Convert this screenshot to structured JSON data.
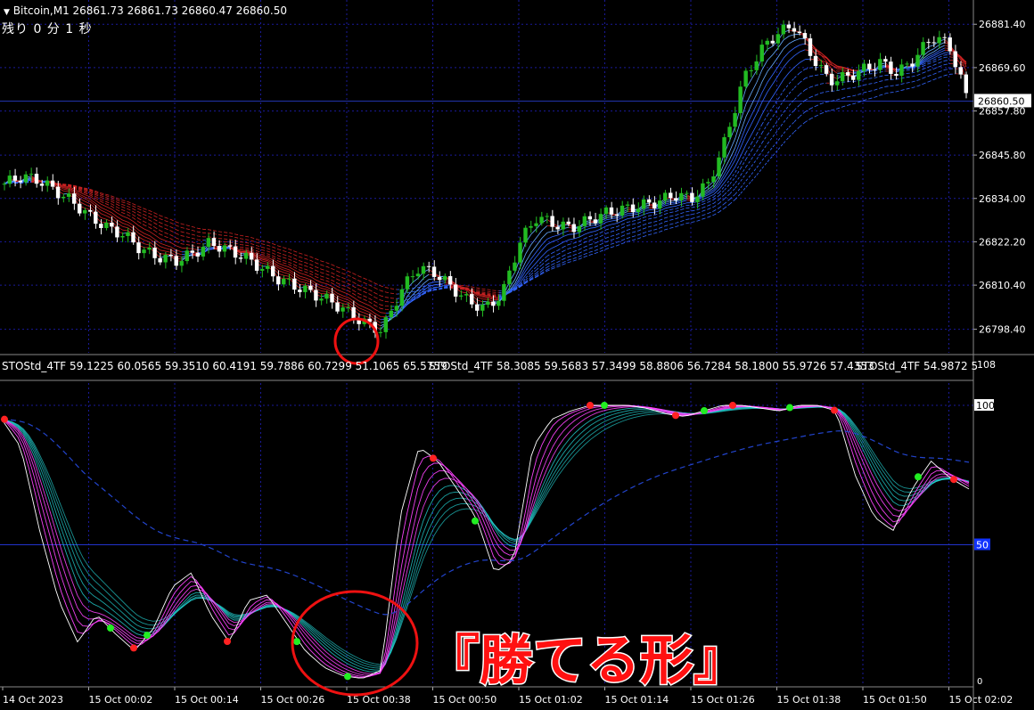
{
  "header": {
    "symbol_line": "Bitcoin,M1  26861.73 26861.73 26860.47 26860.50",
    "countdown": "残り 0 分 1 秒"
  },
  "indicator": {
    "label_1": "STOStd_4TF 59.1225 60.0565 59.3510 60.4191 59.7886 60.7299 51.1065 65.5759",
    "label_2": "STOStd_4TF 58.3085 59.5683 57.3499 58.8806 56.7284 58.1800 55.9726 57.4353",
    "label_3": "STOStd_4TF 54.9872 5",
    "scale_top": "108",
    "level_100": "100",
    "level_50": "50",
    "scale_bottom": "0"
  },
  "price_axis": {
    "ticks": [
      "26881.40",
      "26869.60",
      "26857.80",
      "26845.80",
      "26834.00",
      "26822.20",
      "26810.40",
      "26798.40"
    ],
    "current": "26860.50"
  },
  "time_axis": {
    "ticks": [
      "14 Oct 2023",
      "15 Oct 00:02",
      "15 Oct 00:14",
      "15 Oct 00:26",
      "15 Oct 00:38",
      "15 Oct 00:50",
      "15 Oct 01:02",
      "15 Oct 01:14",
      "15 Oct 01:26",
      "15 Oct 01:38",
      "15 Oct 01:50",
      "15 Oct 02:02"
    ]
  },
  "annotation": {
    "caption": "『勝てる形』"
  },
  "colors": {
    "grid": "#1a1a9a",
    "bull": "#22bb22",
    "bear": "#ffffff",
    "ma_down": "#cc2222",
    "ma_up": "#3366ff",
    "stoch_fast": "#ff44ff",
    "stoch_slow": "#22cccc",
    "marker_red": "#ff2222",
    "marker_green": "#22ee22"
  },
  "chart_data": {
    "type": "line",
    "title": "",
    "price_series": [
      26838,
      26840,
      26839,
      26836,
      26833,
      26829,
      26826,
      26824,
      26820,
      26818,
      26817,
      26819,
      26822,
      26820,
      26818,
      26815,
      26812,
      26810,
      26808,
      26806,
      26803,
      26800,
      26798,
      26808,
      26815,
      26814,
      26810,
      26806,
      26804,
      26808,
      26822,
      26829,
      26827,
      26826,
      26828,
      26830,
      26831,
      26832,
      26833,
      26835,
      26834,
      26838,
      26850,
      26866,
      26874,
      26879,
      26881,
      26873,
      26866,
      26867,
      26869,
      26871,
      26868,
      26872,
      26878,
      26876,
      26862
    ],
    "stoch_series": [
      95,
      85,
      55,
      30,
      15,
      25,
      18,
      12,
      20,
      35,
      40,
      25,
      15,
      30,
      32,
      22,
      12,
      6,
      3,
      2,
      5,
      60,
      85,
      80,
      70,
      60,
      40,
      45,
      85,
      95,
      98,
      100,
      100,
      100,
      99,
      97,
      96,
      98,
      100,
      100,
      99,
      98,
      100,
      100,
      98,
      75,
      60,
      55,
      70,
      80,
      74,
      70
    ],
    "price_ylim": [
      26792,
      26888
    ],
    "stoch_ylim": [
      0,
      108
    ]
  }
}
